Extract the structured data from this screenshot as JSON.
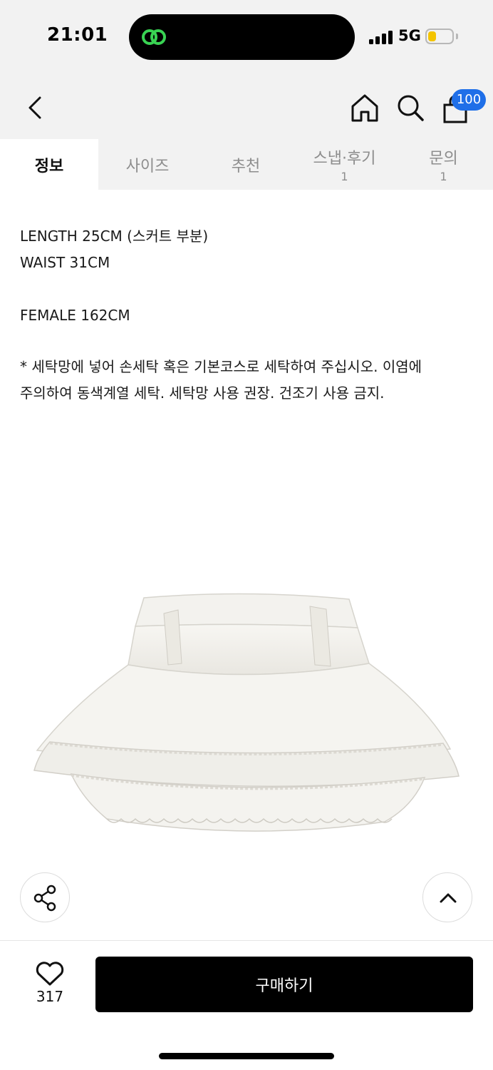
{
  "status_bar": {
    "time": "21:01",
    "network": "5G",
    "battery_level": 0.35,
    "battery_color": "#f4c400"
  },
  "header": {
    "back_icon": "chevron-left-icon",
    "home_icon": "home-icon",
    "search_icon": "search-icon",
    "cart_icon": "shopping-bag-icon",
    "cart_badge": "100",
    "badge_color": "#1f6fe8"
  },
  "tabs": [
    {
      "label": "정보",
      "count": ""
    },
    {
      "label": "사이즈",
      "count": ""
    },
    {
      "label": "추천",
      "count": ""
    },
    {
      "label": "스냅·후기",
      "count": "1"
    },
    {
      "label": "문의",
      "count": "1"
    }
  ],
  "description": {
    "lines": [
      "LENGTH 25CM (스커트 부분)",
      "WAIST 31CM",
      "FEMALE 162CM"
    ],
    "care_note": "* 세탁망에 넣어 손세탁 혹은 기본코스로 세탁하여 주십시오. 이염에 주의하여 동색계열 세탁. 세탁망 사용 권장. 건조기 사용 금지."
  },
  "product_image": {
    "alt": "white lace tiered mini skirt"
  },
  "actions": {
    "share_icon": "share-icon",
    "scroll_top_icon": "chevron-up-icon",
    "like_icon": "heart-icon",
    "like_count": "317",
    "buy_label": "구매하기"
  }
}
